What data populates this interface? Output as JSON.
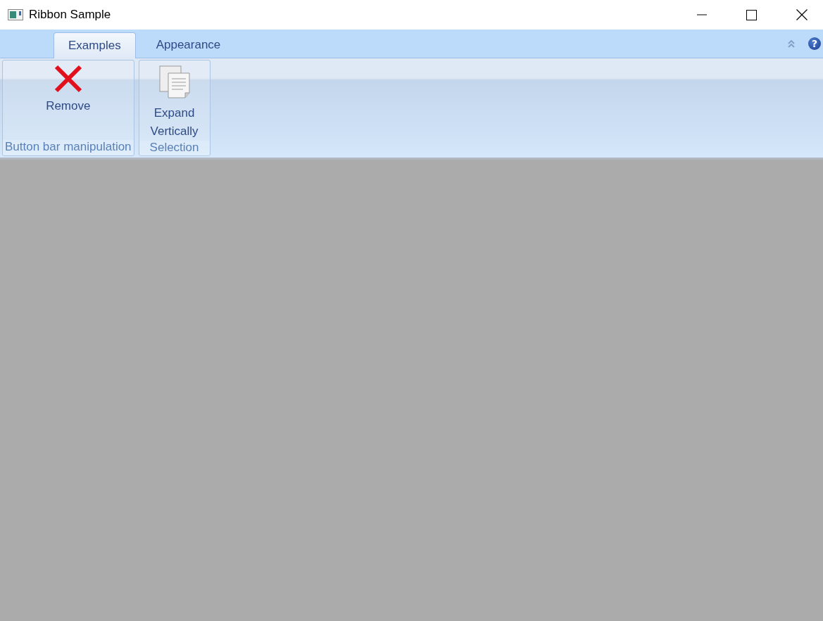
{
  "window": {
    "title": "Ribbon Sample"
  },
  "tabs": [
    {
      "label": "Examples",
      "selected": true
    },
    {
      "label": "Appearance",
      "selected": false
    }
  ],
  "help": {
    "glyph": "?"
  },
  "groups": [
    {
      "label": "Button bar manipulation",
      "buttons": [
        {
          "kind": "remove",
          "label": "Remove"
        }
      ]
    },
    {
      "label": "Selection",
      "buttons": [
        {
          "kind": "copy",
          "label": "Expand Vertically"
        }
      ]
    }
  ]
}
